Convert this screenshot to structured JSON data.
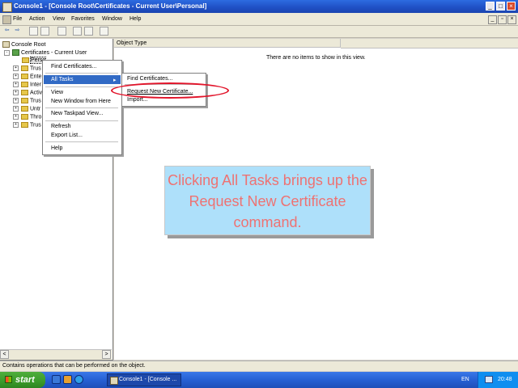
{
  "window": {
    "title": "Console1 - [Console Root\\Certificates - Current User\\Personal]",
    "controls": {
      "minimize": "_",
      "maximize": "□",
      "close": "×"
    },
    "child_controls": {
      "minimize": "_",
      "restore": "▫",
      "close": "×"
    }
  },
  "menubar": {
    "items": [
      "File",
      "Action",
      "View",
      "Favorites",
      "Window",
      "Help"
    ]
  },
  "toolbar": {
    "back": "⇦",
    "forward": "⇨"
  },
  "tree": {
    "items": [
      {
        "label": "Console Root",
        "icon": "console-icon"
      },
      {
        "label": "Certificates - Current User",
        "icon": "certificate-icon"
      },
      {
        "label": "Perso",
        "icon": "folder-icon"
      },
      {
        "label": "Trus",
        "icon": "folder-icon"
      },
      {
        "label": "Ente",
        "icon": "folder-icon"
      },
      {
        "label": "Inter",
        "icon": "folder-icon"
      },
      {
        "label": "Activ",
        "icon": "folder-icon"
      },
      {
        "label": "Trus",
        "icon": "folder-icon"
      },
      {
        "label": "Untr",
        "icon": "folder-icon"
      },
      {
        "label": "Thro",
        "icon": "folder-icon"
      },
      {
        "label": "Trus",
        "icon": "folder-icon"
      }
    ],
    "expander_plus": "+",
    "expander_minus": "-",
    "scroll_left": "<",
    "scroll_right": ">"
  },
  "right_pane": {
    "column_header": "Object Type",
    "empty_message": "There are no items to show in this view."
  },
  "context_menu": {
    "items": [
      "Find Certificates...",
      "All Tasks",
      "View",
      "New Window from Here",
      "New Taskpad View...",
      "Refresh",
      "Export List...",
      "Help"
    ],
    "submenu_arrow": "▸"
  },
  "submenu": {
    "items": [
      "Find Certificates...",
      "Request New Certificate...",
      "Import..."
    ]
  },
  "caption": {
    "text": "Clicking All Tasks brings up the Request New Certificate command."
  },
  "statusbar": {
    "text": "Contains operations that can be performed on the object."
  },
  "taskbar": {
    "start_label": "start",
    "task_button": "Console1 - [Console ...",
    "language": "EN",
    "clock": "20:48"
  },
  "colors": {
    "caption_bg": "#aee0fa",
    "caption_text": "#ee7272",
    "highlight_ring": "#e2142a",
    "menu_highlight": "#316ac5"
  }
}
